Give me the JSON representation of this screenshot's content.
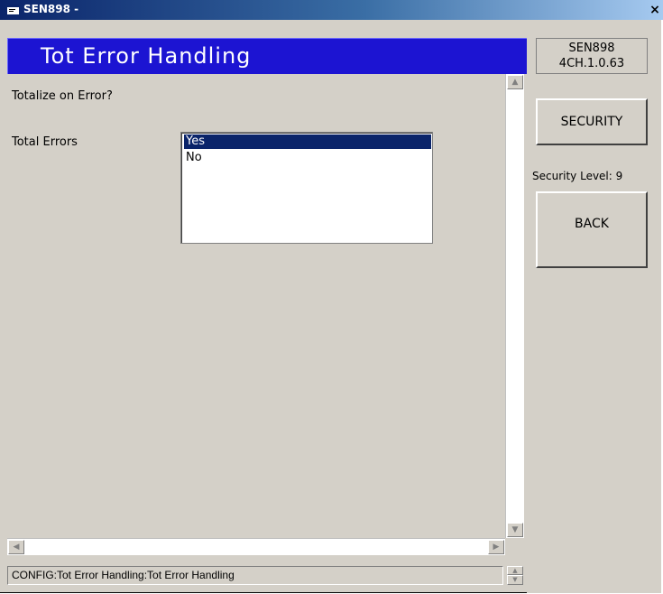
{
  "window": {
    "title": "SEN898 -",
    "close_glyph": "×"
  },
  "header": {
    "title": "Tot Error Handling"
  },
  "form": {
    "question": "Totalize on Error?",
    "field_label": "Total Errors",
    "options": [
      "Yes",
      "No"
    ],
    "selected": "Yes"
  },
  "side_panel": {
    "version_line1": "SEN898",
    "version_line2": "4CH.1.0.63",
    "security_button": "SECURITY",
    "security_level": "Security Level: 9",
    "back_button": "BACK"
  },
  "status_bar": {
    "text": "CONFIG:Tot Error Handling:Tot Error Handling"
  },
  "colors": {
    "header_bg": "#1c14d2",
    "selection_bg": "#0a246a",
    "window_bg": "#d4d0c8"
  },
  "icons": [
    "app-window-icon",
    "close-icon",
    "scroll-up-icon",
    "scroll-down-icon",
    "scroll-left-icon",
    "scroll-right-icon"
  ]
}
